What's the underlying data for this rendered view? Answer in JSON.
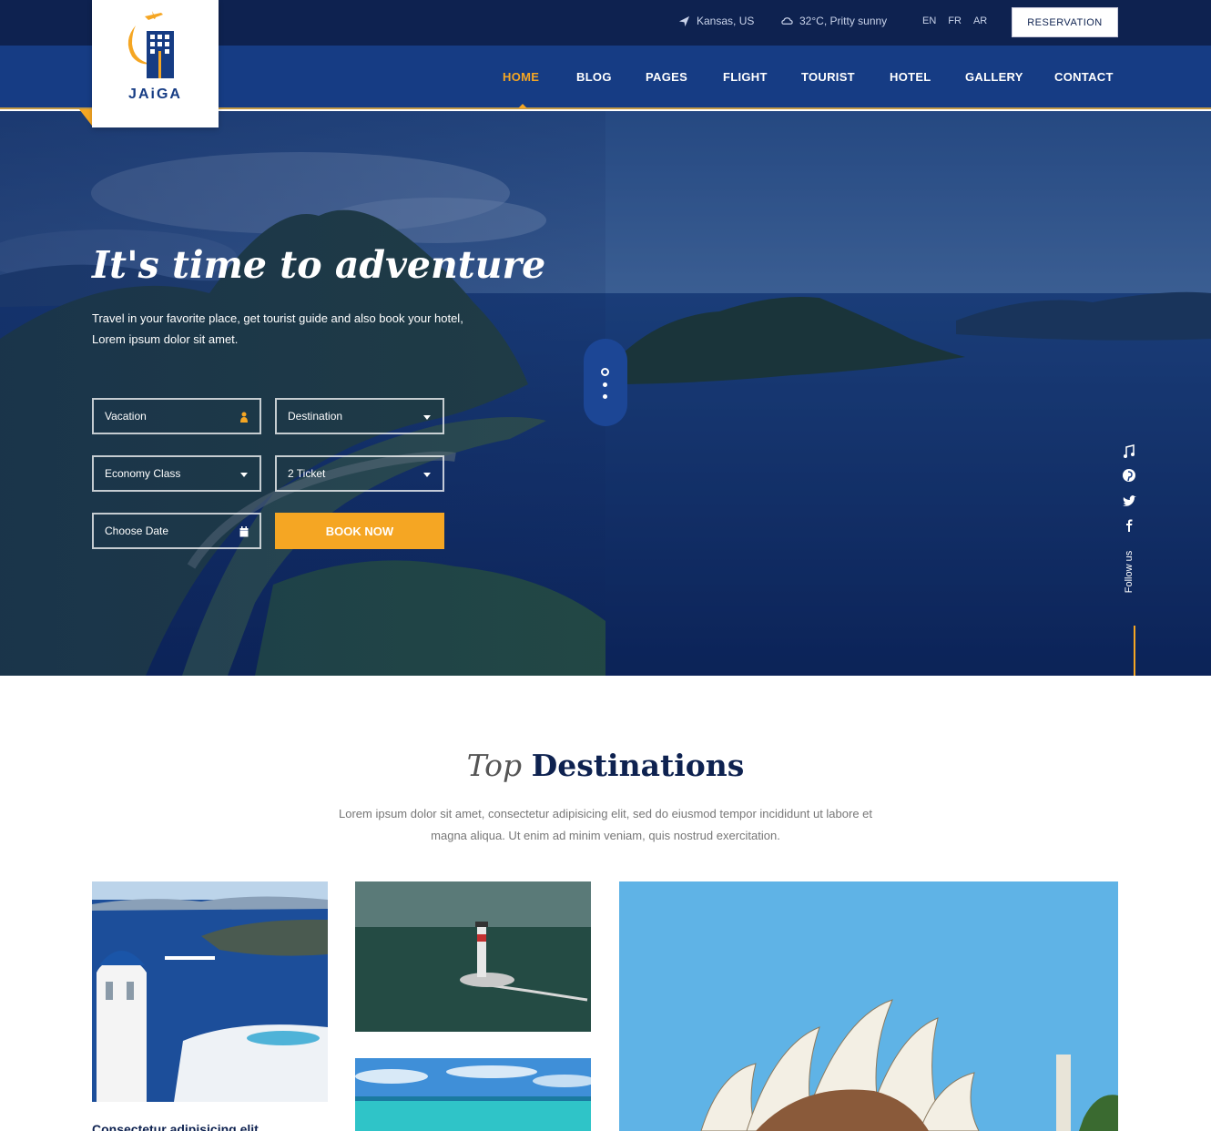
{
  "topbar": {
    "location": "Kansas, US",
    "weather": "32°C, Pritty sunny",
    "languages": [
      "EN",
      "FR",
      "AR"
    ],
    "reservation_label": "RESERVATION"
  },
  "brand": {
    "name": "JAiGA",
    "primary_color": "#163c84",
    "dark_color": "#0e2250",
    "accent_color": "#f5a623"
  },
  "nav": {
    "items": [
      "HOME",
      "BLOG",
      "PAGES",
      "FLIGHT",
      "TOURIST",
      "HOTEL",
      "GALLERY",
      "CONTACT"
    ],
    "active": "HOME"
  },
  "hero": {
    "title": "It's time to adventure",
    "subtitle_line1": "Travel in your favorite place, get tourist guide and also book your hotel,",
    "subtitle_line2": "Lorem ipsum dolor sit amet.",
    "form": {
      "vacation": "Vacation",
      "destination": "Destination",
      "class": "Economy Class",
      "tickets": "2 Ticket",
      "date": "Choose Date",
      "book_label": "BOOK NOW"
    },
    "follow_label": "Follow us",
    "social_icons": [
      "music-icon",
      "pinterest-icon",
      "twitter-icon",
      "facebook-icon"
    ]
  },
  "destinations": {
    "title_light": "Top",
    "title_bold": "Destinations",
    "desc_line1": "Lorem ipsum dolor sit amet, consectetur adipisicing elit, sed do eiusmod tempor incididunt ut labore et",
    "desc_line2": "magna aliqua. Ut enim ad minim veniam, quis nostrud exercitation.",
    "card_caption": "Consectetur adipisicing elit"
  }
}
